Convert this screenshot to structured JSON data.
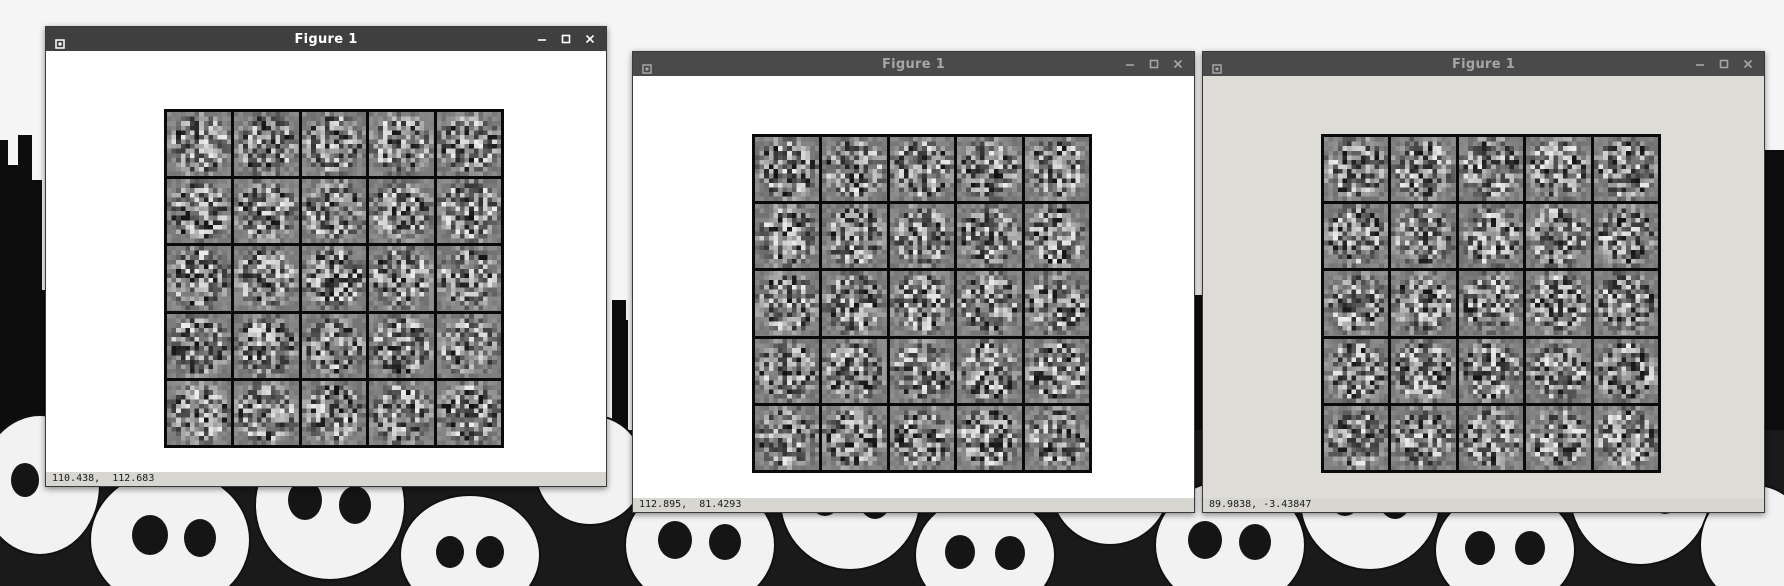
{
  "windows": [
    {
      "id": "win1",
      "title": "Figure 1",
      "active": true,
      "status_text": "110.438,  112.683",
      "canvas_color": "#ffffff",
      "grid": {
        "rows": 5,
        "cols": 5
      }
    },
    {
      "id": "win2",
      "title": "Figure 1",
      "active": false,
      "status_text": "112.895,  81.4293",
      "canvas_color": "#ffffff",
      "grid": {
        "rows": 5,
        "cols": 5
      }
    },
    {
      "id": "win3",
      "title": "Figure 1",
      "active": false,
      "status_text": "89.9838, -3.43847",
      "canvas_color": "#dddcd6",
      "grid": {
        "rows": 5,
        "cols": 5
      }
    }
  ],
  "icons": {
    "menu": "window-menu-icon",
    "minimize": "minimize-icon",
    "maximize": "maximize-icon",
    "close": "close-icon"
  },
  "colors": {
    "titlebar_active": "#3f3f3f",
    "titlebar_inactive": "#4a4a4a",
    "title_active_text": "#ffffff",
    "title_inactive_text": "#a6a6a6",
    "tile_background": "#808080",
    "grid_border": "#0a0a0a",
    "statusbar": "#d7d6d1"
  }
}
